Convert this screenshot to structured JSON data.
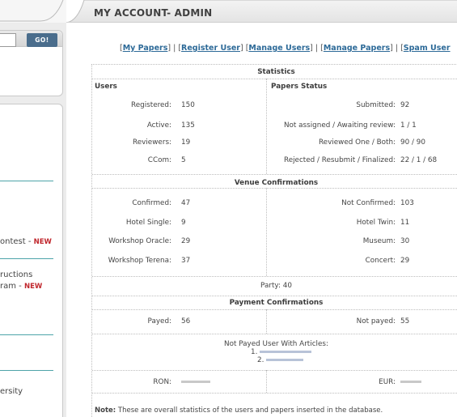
{
  "sidebar": {
    "go_label": "GO!",
    "links": [
      {
        "text": "ontest - ",
        "badge": "NEW"
      },
      {
        "text": "ructions",
        "badge": ""
      },
      {
        "text": "ram - ",
        "badge": "NEW"
      },
      {
        "text": "ersity",
        "badge": ""
      }
    ]
  },
  "main": {
    "title": "MY ACCOUNT- ADMIN"
  },
  "nav": {
    "links": [
      "My Papers",
      "Register User",
      "Manage Users",
      "Manage Papers",
      "Spam User"
    ]
  },
  "statistics": {
    "heading": "Statistics",
    "users": {
      "heading": "Users",
      "rows": [
        {
          "label": "Registered:",
          "value": "150"
        },
        {
          "label": "Active:",
          "value": "135"
        },
        {
          "label": "Reviewers:",
          "value": "19"
        },
        {
          "label": "CCom:",
          "value": "5"
        }
      ]
    },
    "papers": {
      "heading": "Papers Status",
      "rows": [
        {
          "label": "Submitted:",
          "value": "92"
        },
        {
          "label": "Not assigned / Awaiting review:",
          "value": "1 / 1"
        },
        {
          "label": "Reviewed One / Both:",
          "value": "90 / 90"
        },
        {
          "label": "Rejected / Resubmit / Finalized:",
          "value": "22 / 1 / 68"
        }
      ]
    },
    "venue": {
      "heading": "Venue Confirmations",
      "left": [
        {
          "label": "Confirmed:",
          "value": "47"
        },
        {
          "label": "Hotel Single:",
          "value": "9"
        },
        {
          "label": "Workshop Oracle:",
          "value": "29"
        },
        {
          "label": "Workshop Terena:",
          "value": "37"
        }
      ],
      "right": [
        {
          "label": "Not Confirmed:",
          "value": "103"
        },
        {
          "label": "Hotel Twin:",
          "value": "11"
        },
        {
          "label": "Museum:",
          "value": "30"
        },
        {
          "label": "Concert:",
          "value": "29"
        }
      ],
      "party": "Party: 40"
    },
    "payment": {
      "heading": "Payment Confirmations",
      "payed_label": "Payed:",
      "payed_value": "56",
      "not_payed_label": "Not payed:",
      "not_payed_value": "55",
      "not_payed_articles_label": "Not Payed User With Articles:",
      "item1": "1.",
      "item2": "2.",
      "ron_label": "RON:",
      "eur_label": "EUR:"
    },
    "note_label": "Note:",
    "note_text": "These are overall statistics of the users and papers inserted in the database."
  }
}
